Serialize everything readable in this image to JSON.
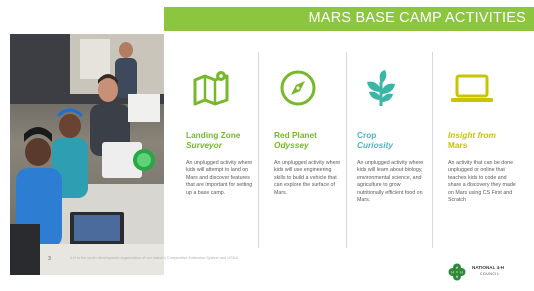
{
  "header": {
    "title": "MARS BASE CAMP ACTIVITIES"
  },
  "colors": {
    "green": "#8cc63f",
    "title_green": "#76b82a",
    "yellow": "#c8c400"
  },
  "activities": [
    {
      "icon": "map-icon",
      "title": "Landing Zone",
      "subtitle": "Surveyor",
      "description": "An unplugged activity where kids will attempt to land on Mars and discover features that are important for setting up a base camp."
    },
    {
      "icon": "compass-icon",
      "title": "Red Planet",
      "subtitle": "Odyssey",
      "description": "An unplugged activity where kids will use engineering skills to build a vehicle that can explore the surface of Mars."
    },
    {
      "icon": "plant-icon",
      "title": "Crop",
      "subtitle": "Curiosity",
      "description": "An unplugged activity where kids will learn about biology, environmental science, and agriculture to grow nutritionally efficient food on Mars."
    },
    {
      "icon": "laptop-icon",
      "title": "Insight from",
      "subtitle": "Mars",
      "description": "An activity that can be done unplugged or online that teaches kids to code and share a discovery they made on Mars using CS First and Scratch"
    }
  ],
  "footer": {
    "slide_number": "3",
    "fine_print": "4-H is the youth development organization of our nation's Cooperative Extension System and USDA.",
    "logo_name": "NATIONAL 4-H",
    "logo_sub": "COUNCIL"
  }
}
